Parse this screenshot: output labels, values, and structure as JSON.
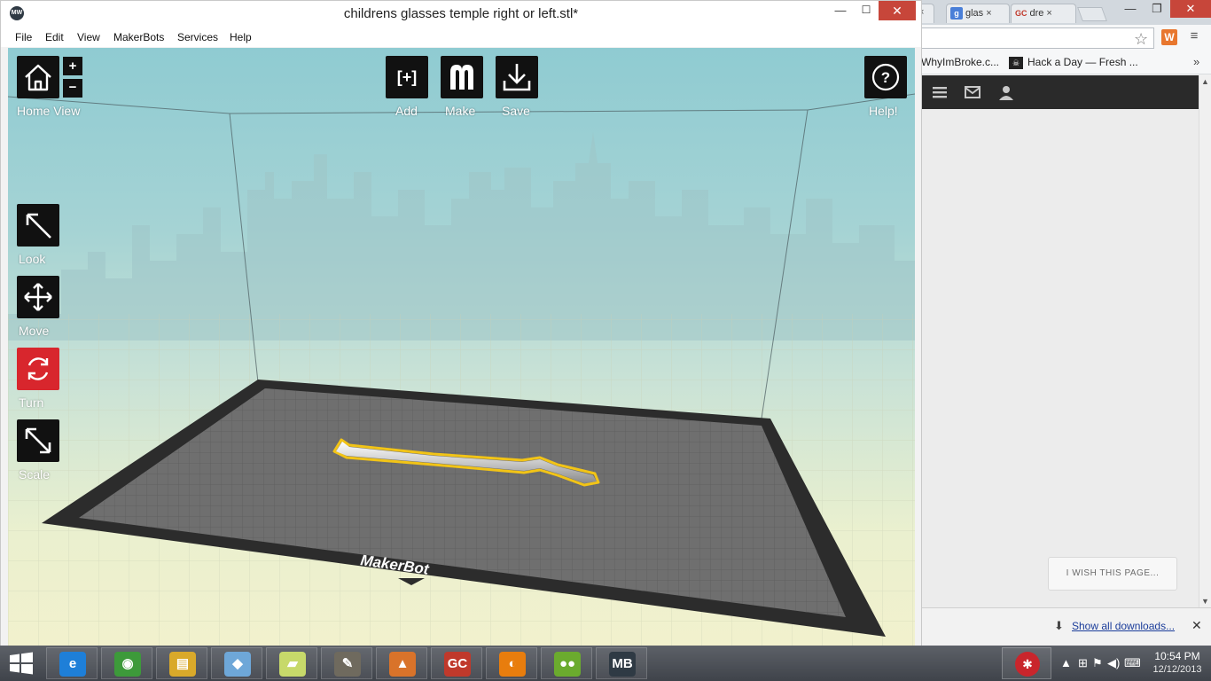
{
  "browser": {
    "tabs": [
      {
        "label": "glas",
        "icon": "google-icon"
      },
      {
        "label": "dre",
        "icon": "gc-icon",
        "icon_text": "GC"
      }
    ],
    "tab_close_glyph": "×",
    "window_controls": {
      "minimize": "—",
      "maximize": "❐",
      "close": "✕"
    },
    "bookmarks": [
      "WhyImBroke.c...",
      "Hack a Day — Fresh ..."
    ],
    "bookmarks_overflow": "»",
    "toolbar_icons": {
      "star": "☆",
      "extension": "W",
      "menu": "≡"
    },
    "site_nav_icons": [
      "menu-icon",
      "mail-icon",
      "user-icon"
    ],
    "wish_button": "I WISH THIS PAGE...",
    "downloads_link": "Show all downloads...",
    "downloads_close": "✕"
  },
  "makerbot": {
    "window_title": "childrens glasses temple right or left.stl*",
    "window_controls": {
      "minimize": "—",
      "maximize": "☐",
      "close": "✕"
    },
    "menu": {
      "file": "File",
      "edit": "Edit",
      "view": "View",
      "makerbots": "MakerBots",
      "services": "Services",
      "help": "Help"
    },
    "toolbar": {
      "home": "Home View",
      "zoom_in": "+",
      "zoom_out": "−",
      "add": "Add",
      "add_glyph": "[+]",
      "make": "Make",
      "make_glyph": "M",
      "save": "Save",
      "help": "Help!",
      "help_glyph": "?"
    },
    "tools": {
      "look": "Look",
      "move": "Move",
      "turn": "Turn",
      "scale": "Scale"
    },
    "active_tool": "turn",
    "platform_brand": "MakerBot",
    "colors": {
      "accent_active": "#d8262d",
      "button_bg": "#111111",
      "selection": "#f2c416"
    }
  },
  "taskbar": {
    "apps": [
      {
        "name": "internet-explorer",
        "glyph": "e",
        "color": "#1e7fd8"
      },
      {
        "name": "chrome",
        "glyph": "◉",
        "color": "#3d9a3a"
      },
      {
        "name": "file-explorer",
        "glyph": "▤",
        "color": "#d9a92a"
      },
      {
        "name": "app-4",
        "glyph": "◆",
        "color": "#6ea7d8"
      },
      {
        "name": "sticky-notes",
        "glyph": "▰",
        "color": "#c7d96a"
      },
      {
        "name": "gimp",
        "glyph": "✎",
        "color": "#6f6a5e"
      },
      {
        "name": "app-7",
        "glyph": "▲",
        "color": "#d9732a"
      },
      {
        "name": "gc",
        "glyph": "GC",
        "color": "#c0392b"
      },
      {
        "name": "blender",
        "glyph": "◐",
        "color": "#e87d0d"
      },
      {
        "name": "peas",
        "glyph": "●●",
        "color": "#6bab2e"
      },
      {
        "name": "makerbot-desktop",
        "glyph": "MB",
        "color": "#2f3a44"
      }
    ],
    "clock_time": "10:54 PM",
    "clock_date": "12/12/2013"
  }
}
